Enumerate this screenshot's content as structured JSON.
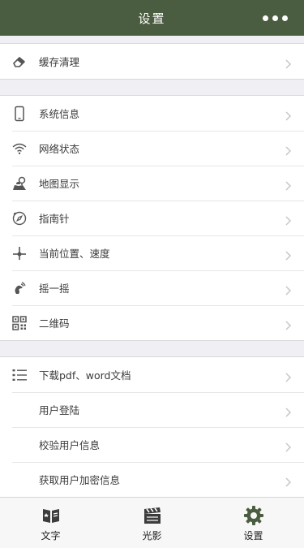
{
  "header": {
    "title": "设置",
    "more_icon": "more-dots-icon"
  },
  "groups": [
    {
      "items": [
        {
          "label": "缓存清理",
          "icon": "eraser-icon"
        }
      ]
    },
    {
      "items": [
        {
          "label": "系统信息",
          "icon": "phone-icon"
        },
        {
          "label": "网络状态",
          "icon": "wifi-icon"
        },
        {
          "label": "地图显示",
          "icon": "map-person-icon"
        },
        {
          "label": "指南针",
          "icon": "compass-icon"
        },
        {
          "label": "当前位置、速度",
          "icon": "location-icon"
        },
        {
          "label": "摇一摇",
          "icon": "shake-icon"
        },
        {
          "label": "二维码",
          "icon": "qrcode-icon"
        }
      ]
    },
    {
      "items": [
        {
          "label": "下载pdf、word文档",
          "icon": "list-icon"
        },
        {
          "label": "用户登陆",
          "icon": ""
        },
        {
          "label": "校验用户信息",
          "icon": ""
        },
        {
          "label": "获取用户加密信息",
          "icon": ""
        }
      ]
    }
  ],
  "tabbar": [
    {
      "label": "文字",
      "icon": "book-icon"
    },
    {
      "label": "光影",
      "icon": "clapperboard-icon"
    },
    {
      "label": "设置",
      "icon": "gear-icon"
    }
  ],
  "colors": {
    "header_bg": "#4b5d40",
    "accent": "#4b5d40"
  }
}
